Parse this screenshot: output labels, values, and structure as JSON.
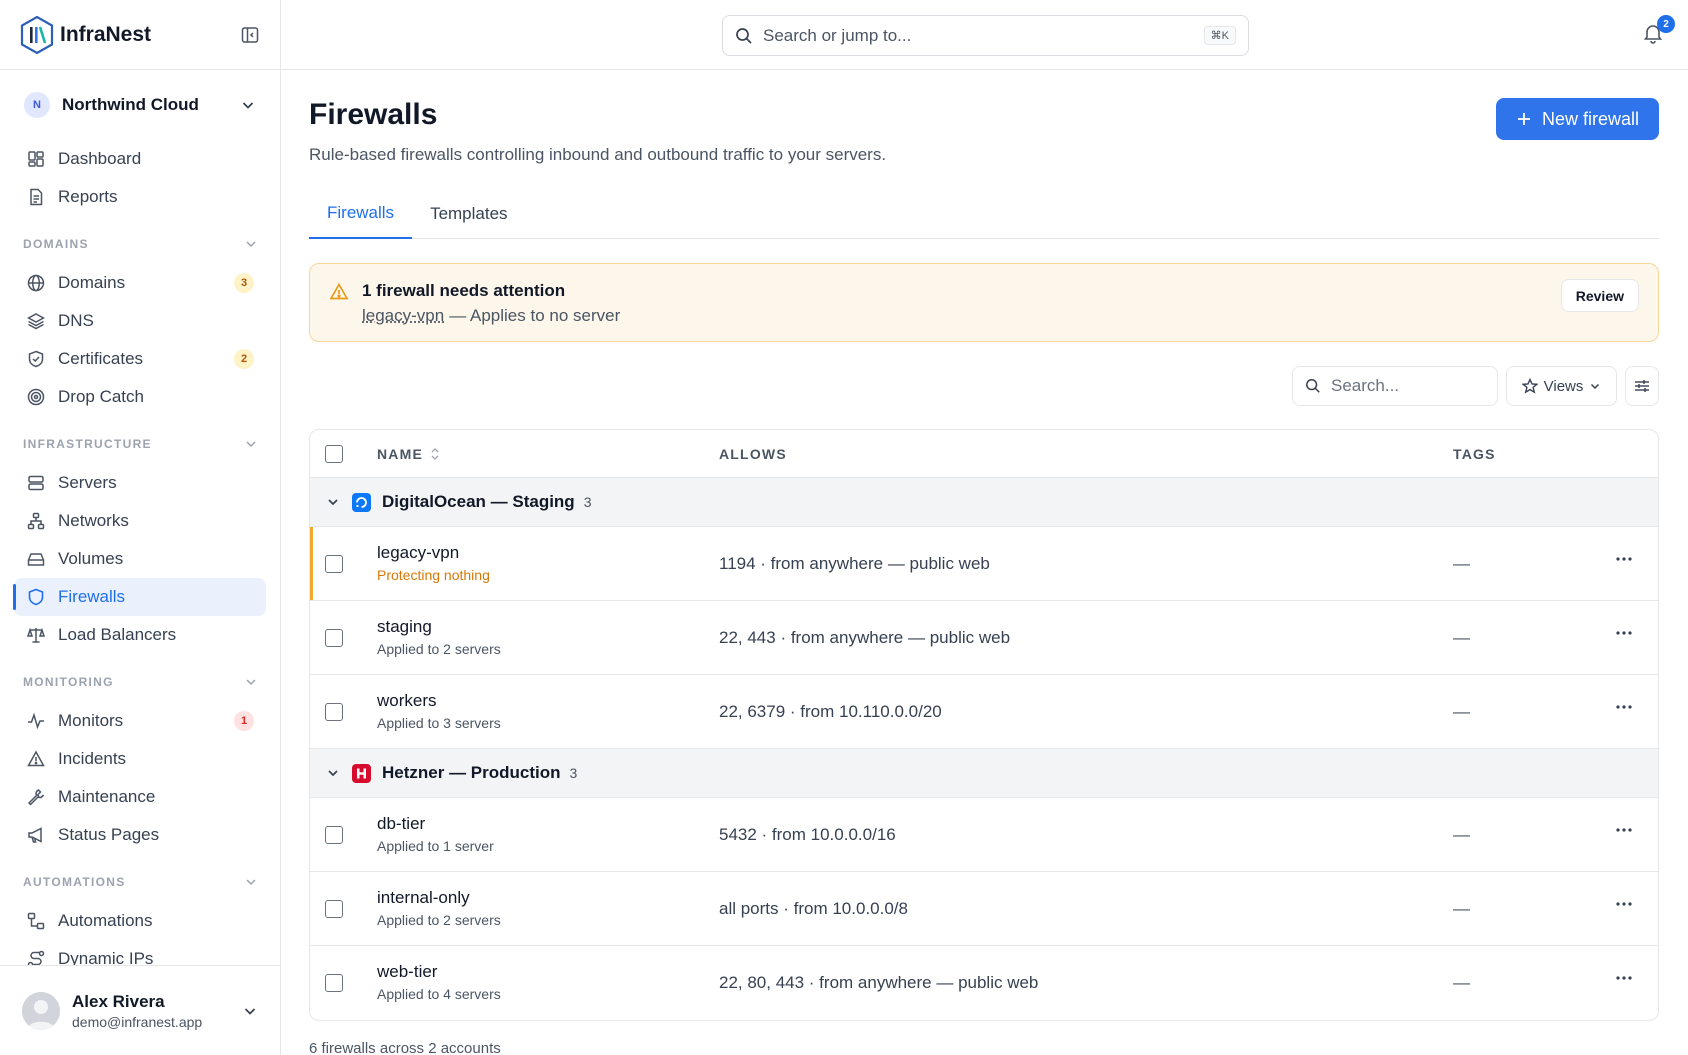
{
  "brand": {
    "name": "InfraNest"
  },
  "org": {
    "initial": "N",
    "name": "Northwind Cloud"
  },
  "nav": {
    "top": [
      {
        "label": "Dashboard",
        "icon": "dashboard-icon"
      },
      {
        "label": "Reports",
        "icon": "document-icon"
      }
    ],
    "sections": [
      {
        "title": "DOMAINS",
        "items": [
          {
            "label": "Domains",
            "icon": "globe-icon",
            "badge": "3",
            "badge_color": "amber"
          },
          {
            "label": "DNS",
            "icon": "layers-icon"
          },
          {
            "label": "Certificates",
            "icon": "shield-check-icon",
            "badge": "2",
            "badge_color": "amber"
          },
          {
            "label": "Drop Catch",
            "icon": "target-icon"
          }
        ]
      },
      {
        "title": "INFRASTRUCTURE",
        "items": [
          {
            "label": "Servers",
            "icon": "server-icon"
          },
          {
            "label": "Networks",
            "icon": "network-icon"
          },
          {
            "label": "Volumes",
            "icon": "drive-icon"
          },
          {
            "label": "Firewalls",
            "icon": "shield-icon",
            "active": true
          },
          {
            "label": "Load Balancers",
            "icon": "scale-icon"
          }
        ]
      },
      {
        "title": "MONITORING",
        "items": [
          {
            "label": "Monitors",
            "icon": "pulse-icon",
            "badge": "1",
            "badge_color": "red"
          },
          {
            "label": "Incidents",
            "icon": "warning-icon"
          },
          {
            "label": "Maintenance",
            "icon": "wrench-icon"
          },
          {
            "label": "Status Pages",
            "icon": "megaphone-icon"
          }
        ]
      },
      {
        "title": "AUTOMATIONS",
        "items": [
          {
            "label": "Automations",
            "icon": "workflow-icon"
          },
          {
            "label": "Dynamic IPs",
            "icon": "route-icon"
          }
        ]
      }
    ]
  },
  "user": {
    "name": "Alex Rivera",
    "email": "demo@infranest.app"
  },
  "search": {
    "placeholder": "Search or jump to...",
    "shortcut": "⌘K"
  },
  "notifications": {
    "count": "2"
  },
  "page": {
    "title": "Firewalls",
    "subtitle": "Rule-based firewalls controlling inbound and outbound traffic to your servers.",
    "new_button": "New firewall"
  },
  "tabs": [
    {
      "label": "Firewalls",
      "active": true
    },
    {
      "label": "Templates",
      "active": false
    }
  ],
  "alert": {
    "title": "1 firewall needs attention",
    "link": "legacy-vpn",
    "message": "— Applies to no server",
    "button": "Review"
  },
  "toolbar": {
    "search_placeholder": "Search...",
    "views_label": "Views"
  },
  "table": {
    "headers": {
      "name": "NAME",
      "allows": "ALLOWS",
      "tags": "TAGS"
    },
    "groups": [
      {
        "name": "DigitalOcean — Staging",
        "count": "3",
        "provider_color": "#0b79f7",
        "rows": [
          {
            "name": "legacy-vpn",
            "sub": "Protecting nothing",
            "warn": true,
            "allows": "1194 · from anywhere — public web",
            "tags": "—"
          },
          {
            "name": "staging",
            "sub": "Applied to 2 servers",
            "allows": "22, 443 · from anywhere — public web",
            "tags": "—"
          },
          {
            "name": "workers",
            "sub": "Applied to 3 servers",
            "allows": "22, 6379 · from 10.110.0.0/20",
            "tags": "—"
          }
        ]
      },
      {
        "name": "Hetzner — Production",
        "count": "3",
        "provider_color": "#d50c2d",
        "rows": [
          {
            "name": "db-tier",
            "sub": "Applied to 1 server",
            "allows": "5432 · from 10.0.0.0/16",
            "tags": "—"
          },
          {
            "name": "internal-only",
            "sub": "Applied to 2 servers",
            "allows": "all ports · from 10.0.0.0/8",
            "tags": "—"
          },
          {
            "name": "web-tier",
            "sub": "Applied to 4 servers",
            "allows": "22, 80, 443 · from anywhere — public web",
            "tags": "—"
          }
        ]
      }
    ],
    "footer": "6 firewalls across 2 accounts"
  }
}
